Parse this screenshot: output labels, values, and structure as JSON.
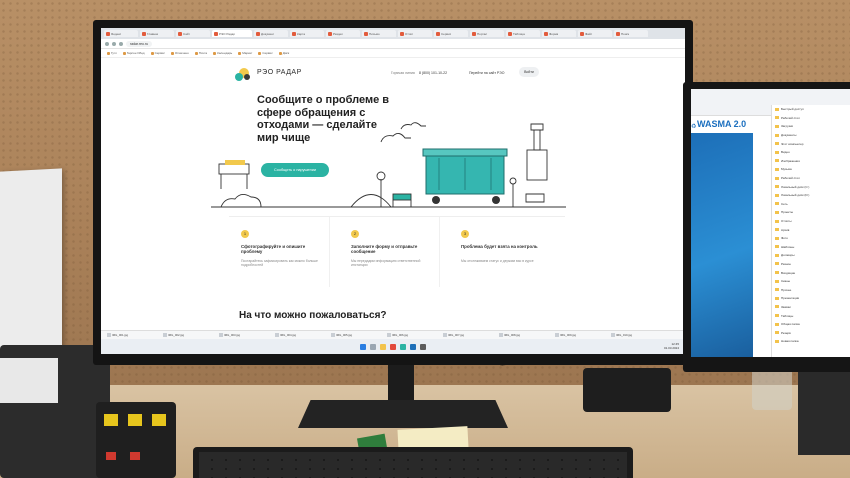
{
  "browser": {
    "tabs": [
      "Яндекс",
      "Главная",
      "Сайт",
      "РЭО Радар",
      "Документ",
      "Карта",
      "Раздел",
      "Письмо",
      "Отчёт",
      "Сервис",
      "Портал",
      "Таблица",
      "Форма",
      "Файл",
      "Поиск"
    ],
    "active_tab_index": 3,
    "url": "radar.reo.ru",
    "bookmarks": [
      "Гугл",
      "Гарсон Обед",
      "Сервис",
      "Отмечено",
      "Почта",
      "Календарь",
      "Маркет",
      "Сервис",
      "Диск"
    ]
  },
  "site": {
    "logo_text": "РЭО РАДАР",
    "hotline_label": "Горячая линия",
    "phone": "8 (800) 101-10-22",
    "goto_label": "Перейти на сайт РЭО",
    "login_label": "Войти",
    "hero_title": "Сообщите о проблеме в сфере обращения с отходами — сделайте мир чище",
    "cta_label": "Сообщить о нарушении",
    "steps": [
      {
        "num": "1",
        "title": "Сфотографируйте и опишите проблему",
        "desc": "Постарайтесь зафиксировать как можно больше подробностей"
      },
      {
        "num": "2",
        "title": "Заполните форму и отправьте сообщение",
        "desc": "Мы передадим информацию ответственной инстанции"
      },
      {
        "num": "3",
        "title": "Проблема будет взята на контроль",
        "desc": "Мы отслеживаем статус и держим вас в курсе"
      }
    ],
    "section_title": "На что можно пожаловаться?"
  },
  "downloads": [
    "IMG_001.jpg",
    "IMG_002.jpg",
    "IMG_003.jpg",
    "IMG_004.jpg",
    "IMG_005.jpg",
    "IMG_006.jpg",
    "IMG_007.jpg",
    "IMG_008.jpg",
    "IMG_009.jpg",
    "IMG_010.jpg"
  ],
  "taskbar": {
    "time": "12:45",
    "date": "01.03.2024"
  },
  "second_screen": {
    "logo": "WASMA 2.0",
    "explorer_items": [
      "Быстрый доступ",
      "Рабочий стол",
      "Загрузки",
      "Документы",
      "Этот компьютер",
      "Видео",
      "Изображения",
      "Музыка",
      "Рабочий стол",
      "Локальный диск (C:)",
      "Локальный диск (D:)",
      "Сеть",
      "Проекты",
      "Отчёты",
      "Архив",
      "Фото",
      "Шаблоны",
      "Договоры",
      "Разное",
      "Входящие",
      "Сканы",
      "Прочее",
      "Презентации",
      "Заявки",
      "Таблицы",
      "Общая папка",
      "Резерв",
      "Новая папка"
    ]
  },
  "colors": {
    "accent": "#2bb3a3",
    "logo_yellow": "#f2c94c",
    "wasma_blue": "#1b6fbf"
  }
}
